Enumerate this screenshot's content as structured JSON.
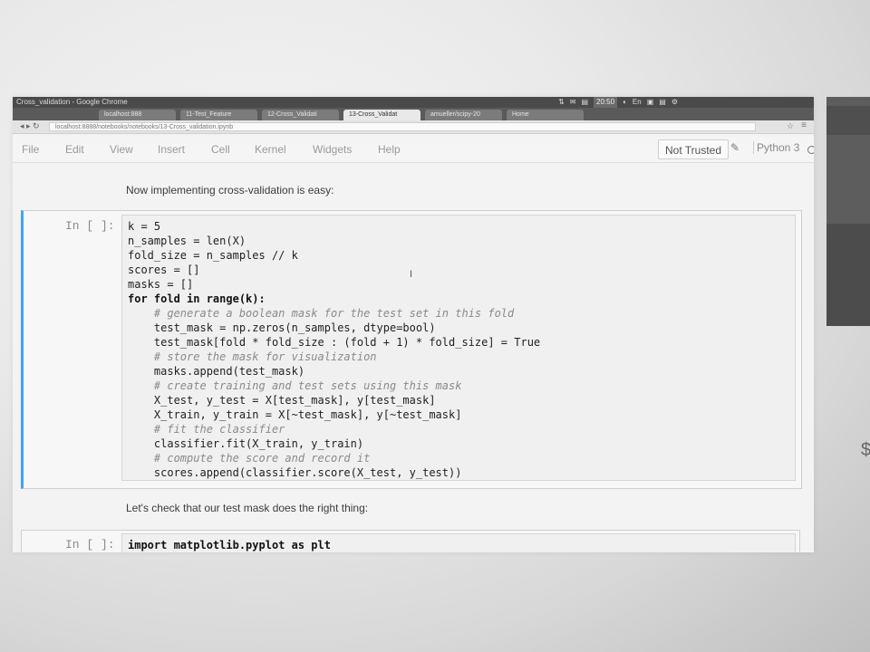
{
  "os": {
    "title": "Cross_validation - Google Chrome",
    "tray": [
      "⇅",
      "✉",
      "▤",
      "20:50",
      "◐",
      "En",
      "▣",
      "▤",
      "⚙"
    ]
  },
  "browser": {
    "tabs": [
      {
        "label": "localhost:888"
      },
      {
        "label": "11-Test_Feature"
      },
      {
        "label": "12-Cross_Validati"
      },
      {
        "label": "13-Cross_Validat"
      },
      {
        "label": "amueller/scipy-20"
      },
      {
        "label": "Home"
      }
    ],
    "url": "localhost:8888/notebooks/notebooks/13-Cross_validation.ipynb"
  },
  "menu": {
    "items": [
      "File",
      "Edit",
      "View",
      "Insert",
      "Cell",
      "Kernel",
      "Widgets",
      "Help"
    ],
    "not_trusted": "Not Trusted",
    "kernel_name": "Python 3"
  },
  "notebook": {
    "md1": "Now implementing cross-validation is easy:",
    "prompt1": "In [ ]:",
    "code1": [
      "k = 5",
      "n_samples = len(X)",
      "fold_size = n_samples // k",
      "scores = []",
      "masks = []",
      "for fold in range(k):",
      "    # generate a boolean mask for the test set in this fold",
      "    test_mask = np.zeros(n_samples, dtype=bool)",
      "    test_mask[fold * fold_size : (fold + 1) * fold_size] = True",
      "    # store the mask for visualization",
      "    masks.append(test_mask)",
      "    # create training and test sets using this mask",
      "    X_test, y_test = X[test_mask], y[test_mask]",
      "    X_train, y_train = X[~test_mask], y[~test_mask]",
      "    # fit the classifier",
      "    classifier.fit(X_train, y_train)",
      "    # compute the score and record it",
      "    scores.append(classifier.score(X_test, y_test))"
    ],
    "md2": "Let's check that our test mask does the right thing:",
    "prompt2": "In [ ]:",
    "code2": "import matplotlib.pyplot as plt"
  }
}
